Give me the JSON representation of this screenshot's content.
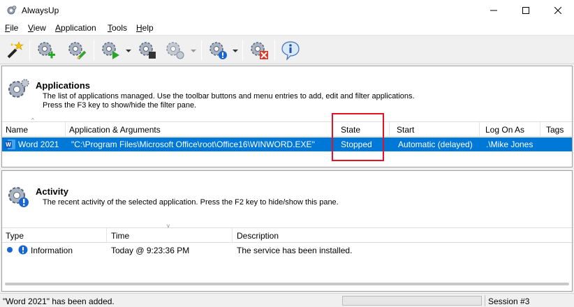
{
  "window": {
    "title": "AlwaysUp"
  },
  "menu": [
    {
      "label": "File",
      "key": "F",
      "rest": "ile"
    },
    {
      "label": "View",
      "key": "V",
      "rest": "iew"
    },
    {
      "label": "Application",
      "key": "A",
      "rest": "pplication"
    },
    {
      "label": "Tools",
      "key": "T",
      "rest": "ools"
    },
    {
      "label": "Help",
      "key": "H",
      "rest": "elp"
    }
  ],
  "toolbar": {
    "icons": [
      "wizard-wand-icon",
      "add-application-icon",
      "edit-application-icon",
      "start-application-icon",
      "stop-application-icon",
      "restart-application-icon",
      "application-info-icon",
      "remove-application-icon",
      "about-icon"
    ]
  },
  "applications_pane": {
    "title": "Applications",
    "desc_line1": "The list of applications managed. Use the toolbar buttons and menu entries to add, edit and filter applications.",
    "desc_line2": "Press the F3 key to show/hide the filter pane.",
    "columns": [
      "Name",
      "Application & Arguments",
      "State",
      "Start",
      "Log On As",
      "Tags"
    ],
    "rows": [
      {
        "name": "Word 2021",
        "app_args": "\"C:\\Program Files\\Microsoft Office\\root\\Office16\\WINWORD.EXE\"",
        "state": "Stopped",
        "start": "Automatic (delayed)",
        "log_on_as": ".\\Mike Jones",
        "tags": ""
      }
    ]
  },
  "activity_pane": {
    "title": "Activity",
    "desc": "The recent activity of the selected application. Press the F2 key to hide/show this pane.",
    "columns": [
      "Type",
      "Time",
      "Description"
    ],
    "rows": [
      {
        "type": "Information",
        "time": "Today @ 9:23:36 PM",
        "description": "The service has been installed."
      }
    ]
  },
  "statusbar": {
    "message": "\"Word 2021\" has been added.",
    "session": "Session #3"
  },
  "colors": {
    "selection": "#0078d7",
    "highlight_box": "#e81123",
    "info_blue": "#1a66d1"
  }
}
